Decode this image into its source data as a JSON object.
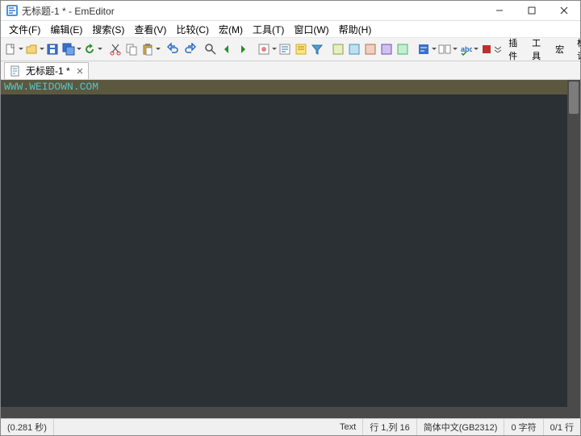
{
  "window": {
    "title": "无标题-1 * - EmEditor"
  },
  "menu": {
    "file": "文件(F)",
    "edit": "编辑(E)",
    "search": "搜索(S)",
    "view": "查看(V)",
    "compare": "比较(C)",
    "macros": "宏(M)",
    "tools": "工具(T)",
    "window": "窗口(W)",
    "help": "帮助(H)"
  },
  "toolbar": {
    "right": {
      "plugins": "插件",
      "tools": "工具",
      "macros": "宏",
      "markers": "标记"
    }
  },
  "tabs": [
    {
      "label": "无标题-1 *"
    }
  ],
  "editor": {
    "line1": "WWW.WEIDOWN.COM"
  },
  "status": {
    "time": "(0.281 秒)",
    "mode": "Text",
    "pos": "行 1,列 16",
    "encoding": "简体中文(GB2312)",
    "chars": "0 字符",
    "lines": "0/1 行"
  },
  "icons": {
    "new": "new",
    "open": "open",
    "save": "save",
    "saveall": "saveall",
    "reload": "reload",
    "cut": "cut",
    "copy": "copy",
    "paste": "paste",
    "undo": "undo",
    "redo": "redo",
    "find": "find",
    "back": "back",
    "forward": "forward",
    "config": "config",
    "popup": "popup",
    "emph": "emph",
    "m1": "m1",
    "m2": "m2",
    "m3": "m3",
    "m4": "m4",
    "m5": "m5",
    "wrap": "wrap",
    "cmp": "cmp",
    "spell": "spell",
    "rec": "rec"
  }
}
